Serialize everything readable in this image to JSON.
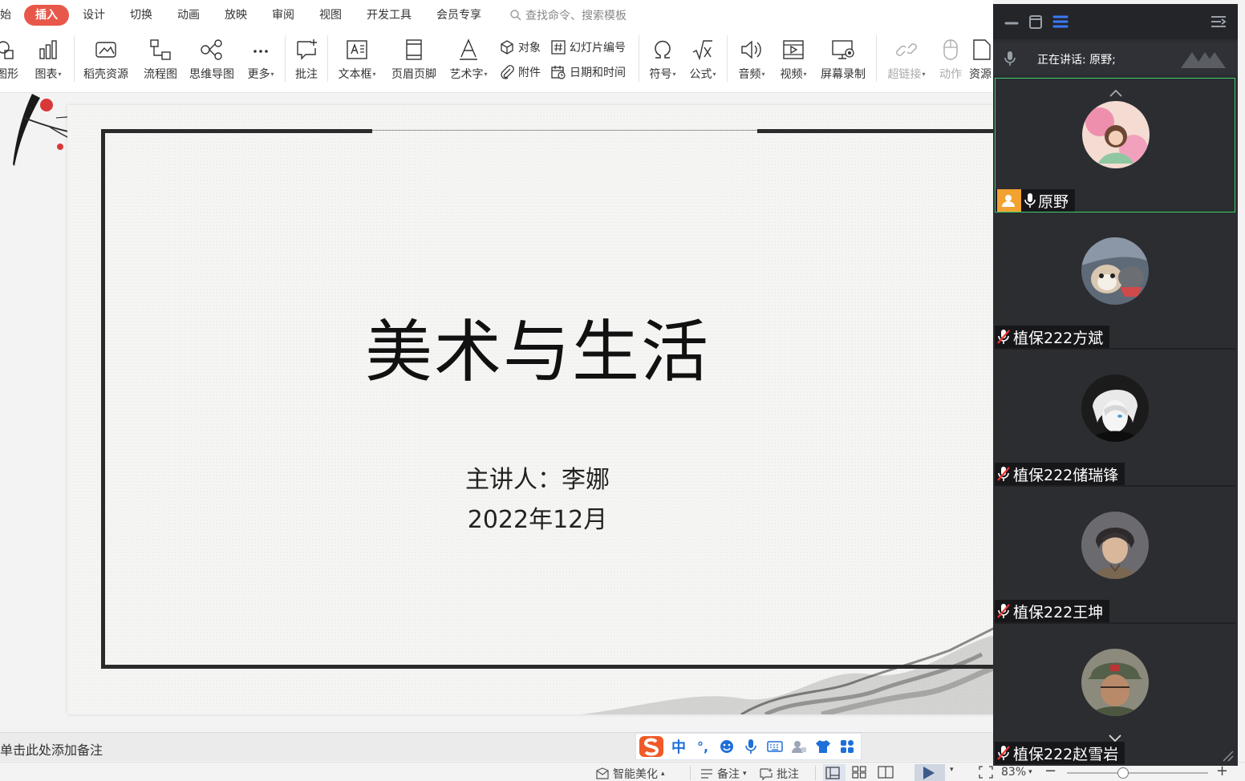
{
  "menu": {
    "tabs": [
      {
        "label": "开始",
        "state": "partial"
      },
      {
        "label": "插入",
        "state": "active"
      },
      {
        "label": "设计"
      },
      {
        "label": "切换"
      },
      {
        "label": "动画"
      },
      {
        "label": "放映"
      },
      {
        "label": "审阅"
      },
      {
        "label": "视图"
      },
      {
        "label": "开发工具"
      },
      {
        "label": "会员专享"
      }
    ],
    "search_placeholder": "查找命令、搜索模板",
    "active_color": "#e8584a"
  },
  "ribbon": {
    "shape": "图形",
    "chart": "图表",
    "docer": "稻壳资源",
    "flowchart": "流程图",
    "mindmap": "思维导图",
    "more": "更多",
    "comment": "批注",
    "textbox": "文本框",
    "header_footer": "页眉页脚",
    "wordart": "艺术字",
    "object": "对象",
    "attachment": "附件",
    "slide_number": "幻灯片编号",
    "datetime": "日期和时间",
    "symbol": "符号",
    "formula": "公式",
    "audio": "音频",
    "video": "视频",
    "screen_record": "屏幕录制",
    "hyperlink": "超链接",
    "action": "动作",
    "resource": "资源"
  },
  "slide": {
    "title": "美术与生活",
    "presenter": "主讲人：李娜",
    "date": "2022年12月"
  },
  "notes": {
    "placeholder": "单击此处添加备注"
  },
  "ime": {
    "zh": "中",
    "punct": "°,"
  },
  "statusbar": {
    "beautify": "智能美化",
    "notes": "备注",
    "comments": "批注",
    "zoom": "83%"
  },
  "meeting": {
    "speaking": "正在讲话: 原野;",
    "participants": [
      {
        "name": "原野",
        "host": true,
        "mic": "on",
        "active": true
      },
      {
        "name": "植保222方斌",
        "mic": "muted"
      },
      {
        "name": "植保222储瑞锋",
        "mic": "muted"
      },
      {
        "name": "植保222王坤",
        "mic": "muted"
      },
      {
        "name": "植保222赵雪岩",
        "mic": "muted"
      }
    ],
    "colors": {
      "panel": "#2b2d31",
      "active_border": "#3ccf6a",
      "host_badge": "#f2a231",
      "accent": "#3a7bff"
    }
  }
}
